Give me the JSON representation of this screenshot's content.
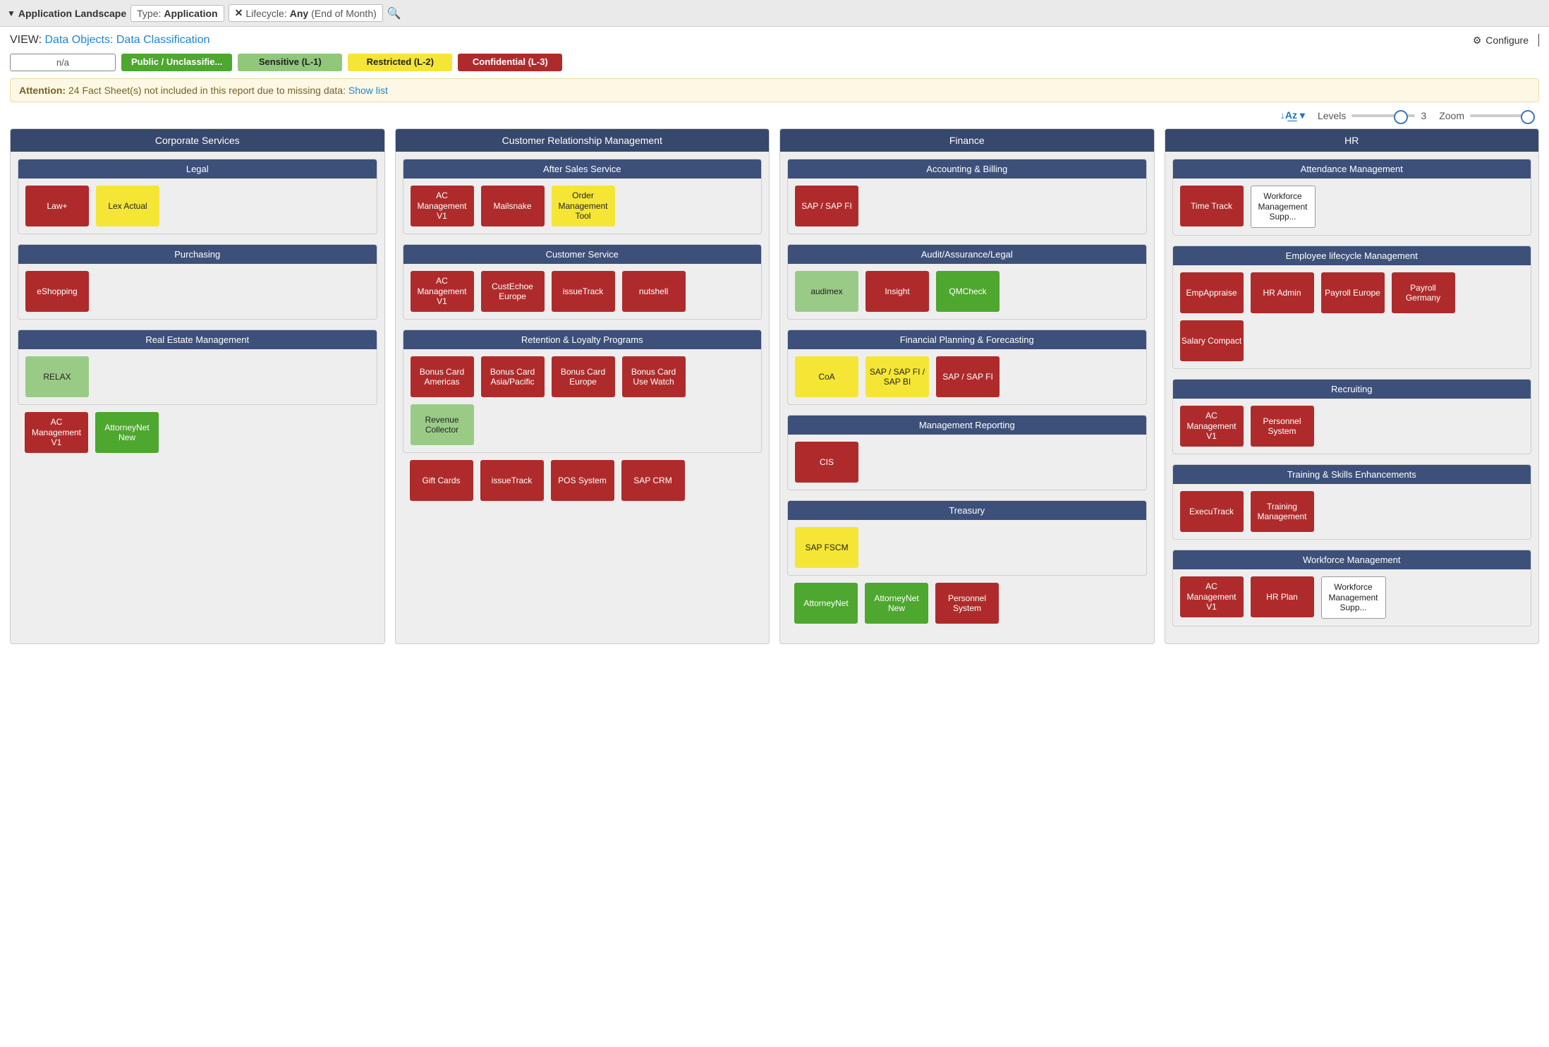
{
  "header": {
    "title": "Application Landscape",
    "filters": [
      {
        "label": "Type:",
        "value": "Application",
        "closable": false
      },
      {
        "label": "Lifecycle:",
        "value": "Any",
        "suffix": "(End of Month)",
        "closable": true
      }
    ]
  },
  "view": {
    "prefix": "VIEW:",
    "link": "Data Objects: Data Classification",
    "configure": "Configure"
  },
  "legend": {
    "na": "n/a",
    "public": "Public / Unclassifie...",
    "sensitive": "Sensitive (L-1)",
    "restricted": "Restricted (L-2)",
    "confidential": "Confidential (L-3)"
  },
  "alert": {
    "attention": "Attention:",
    "count": "24",
    "msg_prefix": " Fact Sheet(s) not included in this report due to missing data: ",
    "link": "Show list"
  },
  "controls": {
    "sort": "↓A͟z ▾",
    "levels_label": "Levels",
    "levels_value": "3",
    "zoom_label": "Zoom"
  },
  "columns": [
    {
      "title": "Corporate Services",
      "subs": [
        {
          "title": "Legal",
          "tiles": [
            {
              "label": "Law+",
              "cls": "t-red"
            },
            {
              "label": "Lex Actual",
              "cls": "t-ylw"
            }
          ]
        },
        {
          "title": "Purchasing",
          "tiles": [
            {
              "label": "eShopping",
              "cls": "t-red"
            }
          ]
        },
        {
          "title": "Real Estate Management",
          "tiles": [
            {
              "label": "RELAX",
              "cls": "t-lgr"
            }
          ]
        }
      ],
      "loose": [
        {
          "label": "AC Management V1",
          "cls": "t-red"
        },
        {
          "label": "AttorneyNet New",
          "cls": "t-grn"
        }
      ]
    },
    {
      "title": "Customer Relationship Management",
      "subs": [
        {
          "title": "After Sales Service",
          "tiles": [
            {
              "label": "AC Management V1",
              "cls": "t-red"
            },
            {
              "label": "Mailsnake",
              "cls": "t-red"
            },
            {
              "label": "Order Management Tool",
              "cls": "t-ylw"
            }
          ]
        },
        {
          "title": "Customer Service",
          "tiles": [
            {
              "label": "AC Management V1",
              "cls": "t-red"
            },
            {
              "label": "CustEchoe Europe",
              "cls": "t-red"
            },
            {
              "label": "issueTrack",
              "cls": "t-red"
            },
            {
              "label": "nutshell",
              "cls": "t-red"
            }
          ]
        },
        {
          "title": "Retention & Loyalty Programs",
          "tiles": [
            {
              "label": "Bonus Card Americas",
              "cls": "t-red"
            },
            {
              "label": "Bonus Card Asia/Pacific",
              "cls": "t-red"
            },
            {
              "label": "Bonus Card Europe",
              "cls": "t-red"
            },
            {
              "label": "Bonus Card Use Watch",
              "cls": "t-red"
            },
            {
              "label": "Revenue Collector",
              "cls": "t-lgr"
            }
          ]
        }
      ],
      "loose": [
        {
          "label": "Gift Cards",
          "cls": "t-red"
        },
        {
          "label": "issueTrack",
          "cls": "t-red"
        },
        {
          "label": "POS System",
          "cls": "t-red"
        },
        {
          "label": "SAP CRM",
          "cls": "t-red"
        }
      ]
    },
    {
      "title": "Finance",
      "subs": [
        {
          "title": "Accounting & Billing",
          "tiles": [
            {
              "label": "SAP / SAP FI",
              "cls": "t-red"
            }
          ]
        },
        {
          "title": "Audit/Assurance/Legal",
          "tiles": [
            {
              "label": "audimex",
              "cls": "t-lgr"
            },
            {
              "label": "Insight",
              "cls": "t-red"
            },
            {
              "label": "QMCheck",
              "cls": "t-grn"
            }
          ]
        },
        {
          "title": "Financial Planning & Forecasting",
          "tiles": [
            {
              "label": "CoA",
              "cls": "t-ylw"
            },
            {
              "label": "SAP / SAP FI / SAP BI",
              "cls": "t-ylw"
            },
            {
              "label": "SAP / SAP FI",
              "cls": "t-red"
            }
          ]
        },
        {
          "title": "Management Reporting",
          "tiles": [
            {
              "label": "CIS",
              "cls": "t-red"
            }
          ]
        },
        {
          "title": "Treasury",
          "tiles": [
            {
              "label": "SAP FSCM",
              "cls": "t-ylw"
            }
          ]
        }
      ],
      "loose": [
        {
          "label": "AttorneyNet",
          "cls": "t-grn"
        },
        {
          "label": "AttorneyNet New",
          "cls": "t-grn"
        },
        {
          "label": "Personnel System",
          "cls": "t-red"
        }
      ]
    },
    {
      "title": "HR",
      "subs": [
        {
          "title": "Attendance Management",
          "tiles": [
            {
              "label": "Time Track",
              "cls": "t-red"
            },
            {
              "label": "Workforce Management Supp...",
              "cls": "t-na"
            }
          ]
        },
        {
          "title": "Employee lifecycle Management",
          "tiles": [
            {
              "label": "EmpAppraise",
              "cls": "t-red"
            },
            {
              "label": "HR Admin",
              "cls": "t-red"
            },
            {
              "label": "Payroll Europe",
              "cls": "t-red"
            },
            {
              "label": "Payroll Germany",
              "cls": "t-red"
            },
            {
              "label": "Salary Compact",
              "cls": "t-red"
            }
          ]
        },
        {
          "title": "Recruiting",
          "tiles": [
            {
              "label": "AC Management V1",
              "cls": "t-red"
            },
            {
              "label": "Personnel System",
              "cls": "t-red"
            }
          ]
        },
        {
          "title": "Training & Skills Enhancements",
          "tiles": [
            {
              "label": "ExecuTrack",
              "cls": "t-red"
            },
            {
              "label": "Training Management",
              "cls": "t-red"
            }
          ]
        },
        {
          "title": "Workforce Management",
          "tiles": [
            {
              "label": "AC Management V1",
              "cls": "t-red"
            },
            {
              "label": "HR Plan",
              "cls": "t-red"
            },
            {
              "label": "Workforce Management Supp...",
              "cls": "t-na"
            }
          ]
        }
      ],
      "loose": []
    }
  ]
}
